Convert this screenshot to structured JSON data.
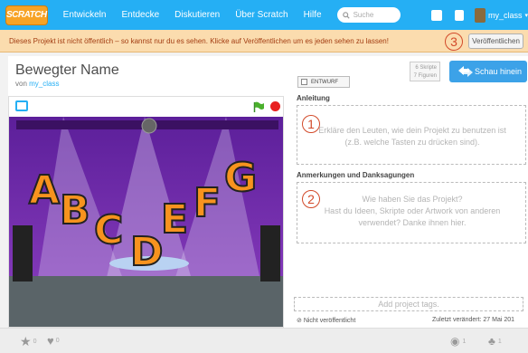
{
  "nav": {
    "logo": "SCRATCH",
    "items": [
      "Entwickeln",
      "Entdecke",
      "Diskutieren",
      "Über Scratch",
      "Hilfe"
    ],
    "search_placeholder": "Suche",
    "username": "my_class"
  },
  "banner": {
    "text": "Dieses Projekt ist nicht öffentlich – so kannst nur du es sehen. Klicke auf Veröffentlichen um es jeden sehen zu lassen!",
    "publish_label": "Veröffentlichen"
  },
  "annotations": [
    "1",
    "2",
    "3"
  ],
  "project": {
    "title": "Bewegter Name",
    "by_prefix": "von",
    "author": "my_class",
    "draft_label": "ENTWURF",
    "stats_scripts": "6 Skripte",
    "stats_sprites": "7 Figuren",
    "see_inside": "Schau hinein",
    "stage_letters": [
      "A",
      "B",
      "C",
      "D",
      "E",
      "F",
      "G"
    ]
  },
  "instructions": {
    "title": "Anleitung",
    "placeholder_line1": "Erkläre den Leuten, wie dein Projekt zu benutzen ist",
    "placeholder_line2": "(z.B. welche Tasten zu drücken sind)."
  },
  "notes": {
    "title": "Anmerkungen und Danksagungen",
    "placeholder_line1": "Wie haben Sie das Projekt?",
    "placeholder_line2": "Hast du Ideen, Skripte oder Artwork von anderen",
    "placeholder_line3": "verwendet? Danke ihnen hier."
  },
  "tags_placeholder": "Add project tags.",
  "footer": {
    "status": "Nicht veröffentlicht",
    "modified": "Zuletzt verändert: 27 Mai 201"
  },
  "bottom": {
    "favorites": "0",
    "loves": "0",
    "views": "1",
    "remixes": "1"
  },
  "colors": {
    "nav_bg": "#25aff4",
    "banner_bg": "#fbdcae",
    "banner_text": "#a33d12",
    "annotation": "#d24a2a",
    "letter_fill": "#f7931e"
  }
}
